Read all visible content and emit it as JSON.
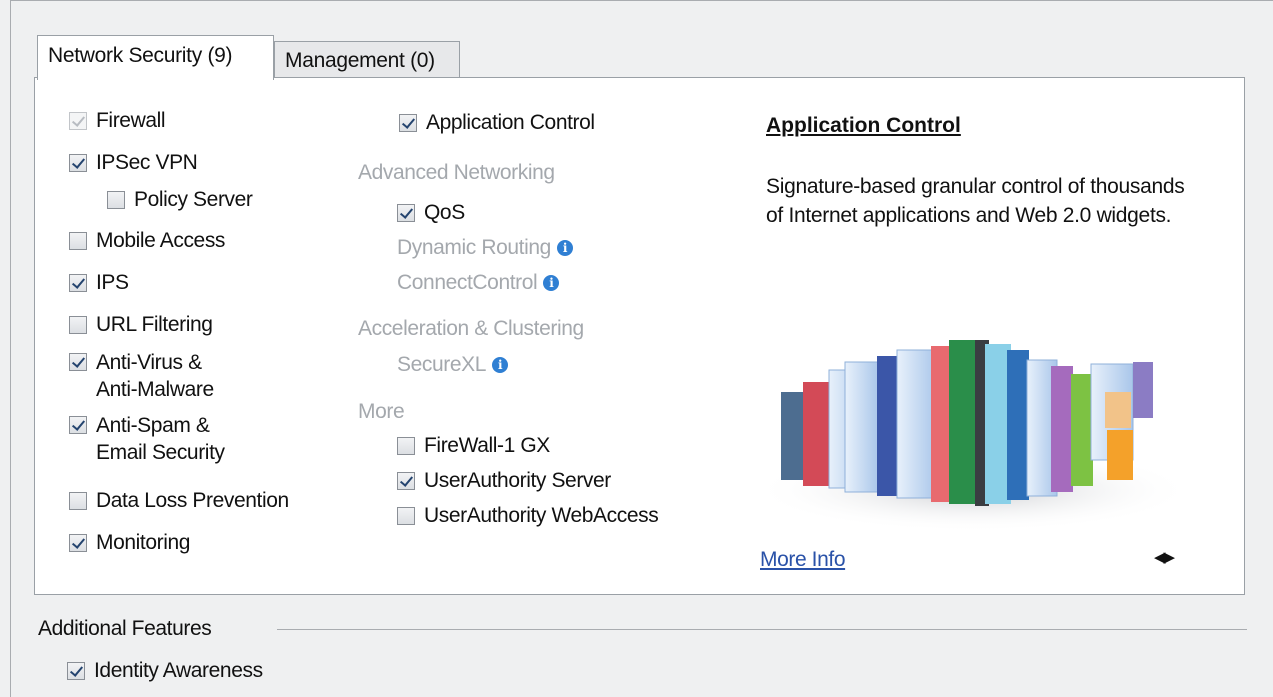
{
  "tabs": [
    {
      "label": "Network Security (9)",
      "active": true
    },
    {
      "label": "Management (0)",
      "active": false
    }
  ],
  "left_column": [
    {
      "label": "Firewall",
      "checked": true,
      "disabled": true
    },
    {
      "label": "IPSec VPN",
      "checked": true
    },
    {
      "label": "Policy Server",
      "checked": false
    },
    {
      "label": "Mobile Access",
      "checked": false
    },
    {
      "label": "IPS",
      "checked": true
    },
    {
      "label": "URL Filtering",
      "checked": false
    },
    {
      "label": "Anti-Virus &",
      "label2": "Anti-Malware",
      "checked": true
    },
    {
      "label": "Anti-Spam &",
      "label2": "Email Security",
      "checked": true
    },
    {
      "label": "Data Loss Prevention",
      "checked": false
    },
    {
      "label": "Monitoring",
      "checked": true
    }
  ],
  "middle_column": {
    "application_control": {
      "label": "Application Control",
      "checked": true
    },
    "advanced_networking": {
      "heading": "Advanced Networking",
      "qos": {
        "label": "QoS",
        "checked": true
      },
      "dynamic_routing": "Dynamic Routing",
      "connect_control": "ConnectControl"
    },
    "acceleration": {
      "heading": "Acceleration & Clustering",
      "securexl": "SecureXL"
    },
    "more": {
      "heading": "More",
      "items": [
        {
          "label": "FireWall-1 GX",
          "checked": false
        },
        {
          "label": "UserAuthority Server",
          "checked": true
        },
        {
          "label": "UserAuthority WebAccess",
          "checked": false
        }
      ]
    }
  },
  "description": {
    "title": "Application Control",
    "body": "Signature-based granular control of thousands of Internet applications and Web 2.0 widgets.",
    "more_info": "More Info",
    "nav_arrows": "◀▶"
  },
  "icons": {
    "info": "i"
  },
  "additional_features": {
    "heading": "Additional Features",
    "identity_awareness": {
      "label": "Identity Awareness",
      "checked": true
    }
  },
  "colors": {
    "link": "#2a52a8",
    "info_icon": "#2f7fd3",
    "disabled_text": "#a4a8ad"
  }
}
